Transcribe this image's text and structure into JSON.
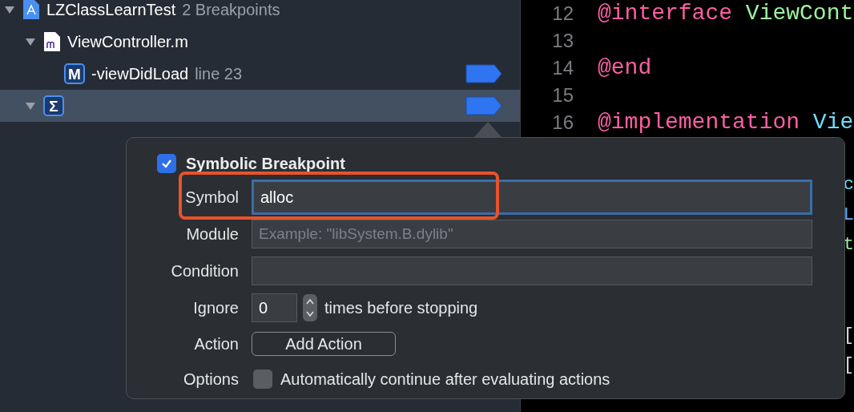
{
  "navigator": {
    "items": [
      {
        "kind": "project",
        "expanded": true,
        "selected": false,
        "label": "LZClassLearnTest",
        "detail": "2 Breakpoints",
        "children": [
          {
            "kind": "file",
            "expanded": true,
            "selected": false,
            "label": "ViewController.m",
            "children": [
              {
                "kind": "method",
                "selected": false,
                "icon_text": "M",
                "label": "-viewDidLoad",
                "detail": "line 23",
                "breakpoint": true
              }
            ]
          },
          {
            "kind": "symbolic",
            "expanded": true,
            "selected": true,
            "icon_text": "Σ",
            "breakpoint": true
          }
        ]
      }
    ]
  },
  "editor": {
    "lines": [
      {
        "number": "12",
        "tokens": [
          {
            "kind": "keyword",
            "text": "@interface"
          },
          {
            "kind": "type",
            "text": " ViewCont"
          }
        ]
      },
      {
        "number": "13"
      },
      {
        "number": "14",
        "tokens": [
          {
            "kind": "keyword",
            "text": "@end"
          }
        ]
      },
      {
        "number": "15"
      },
      {
        "number": "16",
        "tokens": [
          {
            "kind": "keyword",
            "text": "@implementation"
          },
          {
            "kind": "class",
            "text": " Vie"
          }
        ]
      }
    ],
    "fragments_upper": [
      {
        "kind": "class",
        "text": "c"
      },
      {
        "kind": "macro",
        "text": "L"
      },
      {
        "kind": "type",
        "text": "t"
      }
    ],
    "fragments_lower": [
      {
        "kind": "plain",
        "text": "["
      },
      {
        "kind": "plain",
        "text": "["
      }
    ]
  },
  "popover": {
    "enabled": true,
    "title": "Symbolic Breakpoint",
    "fields": [
      {
        "kind": "text",
        "label": "Symbol",
        "value": "alloc",
        "focused": true,
        "highlighted": true
      },
      {
        "kind": "text",
        "label": "Module",
        "placeholder": "Example: \"libSystem.B.dylib\"",
        "focused": false
      },
      {
        "kind": "text",
        "label": "Condition",
        "focused": false
      },
      {
        "kind": "stepper",
        "label": "Ignore",
        "value": "0",
        "suffix": "times before stopping"
      },
      {
        "kind": "button",
        "label": "Action",
        "button": "Add Action"
      },
      {
        "kind": "checkbox",
        "label": "Options",
        "checked": false,
        "text": "Automatically continue after evaluating actions"
      }
    ]
  }
}
